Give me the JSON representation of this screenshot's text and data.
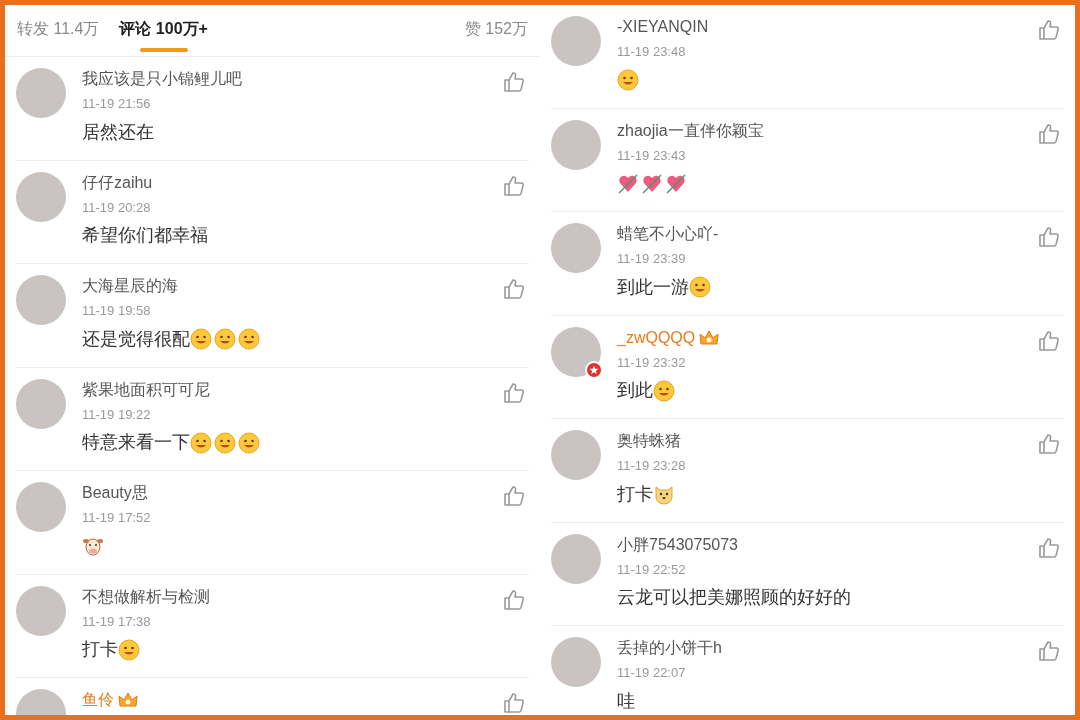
{
  "tabs": [
    {
      "label": "转发 11.4万",
      "selected": false
    },
    {
      "label": "评论 100万+",
      "selected": true
    },
    {
      "label": "赞 152万",
      "selected": false
    }
  ],
  "left_comments": [
    {
      "name": "我应该是只小锦鲤儿吧",
      "vip": false,
      "verified": false,
      "time": "11-19 21:56",
      "text": "居然还在"
    },
    {
      "name": "仔仔zaihu",
      "vip": false,
      "verified": false,
      "time": "11-19 20:28",
      "text": "希望你们都幸福"
    },
    {
      "name": "大海星辰的海",
      "vip": false,
      "verified": false,
      "time": "11-19 19:58",
      "text": "还是觉得很配",
      "stickers": [
        {
          "kind": "face"
        },
        {
          "kind": "face"
        },
        {
          "kind": "face"
        }
      ]
    },
    {
      "name": "紫果地面积可可尼",
      "vip": false,
      "verified": false,
      "time": "11-19 19:22",
      "text": "特意来看一下",
      "stickers": [
        {
          "kind": "face"
        },
        {
          "kind": "face"
        },
        {
          "kind": "face"
        }
      ]
    },
    {
      "name": "Beauty思",
      "vip": false,
      "verified": false,
      "time": "11-19 17:52",
      "stickers": [
        {
          "kind": "cow"
        }
      ]
    },
    {
      "name": "不想做解析与检测",
      "vip": false,
      "verified": false,
      "time": "11-19 17:38",
      "text": "打卡",
      "stickers": [
        {
          "kind": "face"
        }
      ]
    },
    {
      "name": "鱼伶",
      "vip": true,
      "verified": false
    }
  ],
  "right_comments": [
    {
      "name": "-XIEYANQIN",
      "vip": false,
      "verified": false,
      "time": "11-19 23:48",
      "stickers": [
        {
          "kind": "face"
        }
      ]
    },
    {
      "name": "zhaojia一直伴你颖宝",
      "vip": false,
      "verified": false,
      "time": "11-19 23:43",
      "stickers": [
        {
          "kind": "heart"
        },
        {
          "kind": "heart"
        },
        {
          "kind": "heart"
        }
      ]
    },
    {
      "name": "蜡笔不小心吖-",
      "vip": false,
      "verified": false,
      "time": "11-19 23:39",
      "text": "到此一游",
      "stickers": [
        {
          "kind": "face"
        }
      ]
    },
    {
      "name": "_zwQQQQ",
      "vip": true,
      "verified": true,
      "time": "11-19 23:32",
      "text": "到此",
      "stickers": [
        {
          "kind": "face"
        }
      ]
    },
    {
      "name": "奥特蛛猪",
      "vip": false,
      "verified": false,
      "time": "11-19 23:28",
      "text": "打卡",
      "stickers": [
        {
          "kind": "dog"
        }
      ]
    },
    {
      "name": "小胖7543075073",
      "vip": false,
      "verified": false,
      "time": "11-19 22:52",
      "text": "云龙可以把美娜照顾的好好的"
    },
    {
      "name": "丢掉的小饼干h",
      "vip": false,
      "verified": false,
      "time": "11-19 22:07",
      "text": "哇"
    }
  ]
}
